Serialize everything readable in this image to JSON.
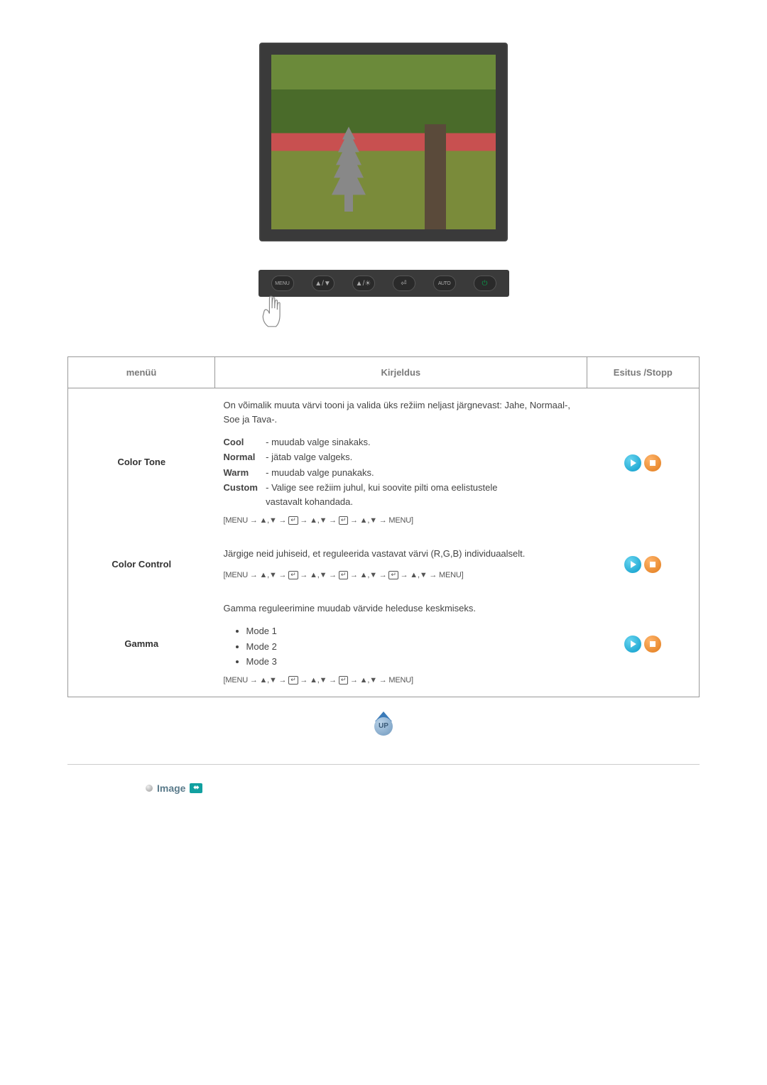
{
  "monitor_buttons": [
    "MENU",
    "▲/▼",
    "▲/☀",
    "⏎",
    "AUTO",
    "⏻"
  ],
  "table": {
    "headers": {
      "menu": "menüü",
      "desc": "Kirjeldus",
      "play": "Esitus /Stopp"
    },
    "rows": [
      {
        "label": "Color Tone",
        "intro": "On võimalik muuta värvi tooni ja valida üks režiim neljast järgnevast: Jahe, Normaal-, Soe ja Tava-.",
        "options": [
          {
            "name": "Cool",
            "text": "- muudab valge sinakaks."
          },
          {
            "name": "Normal",
            "text": "- jätab valge valgeks."
          },
          {
            "name": "Warm",
            "text": "- muudab valge punakaks."
          },
          {
            "name": "Custom",
            "text": "- Valige see režiim juhul, kui soovite pilti oma eelistustele vastavalt kohandada."
          }
        ],
        "nav": "[MENU → ▲,▼ → ⏎ → ▲,▼ → ⏎ → ▲,▼ → MENU]"
      },
      {
        "label": "Color Control",
        "intro": "Järgige neid juhiseid, et reguleerida vastavat värvi (R,G,B) individuaalselt.",
        "nav": "[MENU → ▲,▼ → ⏎ → ▲,▼ → ⏎ → ▲,▼ → ⏎ → ▲,▼ → MENU]"
      },
      {
        "label": "Gamma",
        "intro": "Gamma reguleerimine muudab värvide heleduse keskmiseks.",
        "modes": [
          "Mode 1",
          "Mode 2",
          "Mode 3"
        ],
        "nav": "[MENU → ▲,▼ → ⏎ → ▲,▼ → ⏎ → ▲,▼ → MENU]"
      }
    ]
  },
  "up_label": "UP",
  "section": {
    "title": "Image"
  }
}
